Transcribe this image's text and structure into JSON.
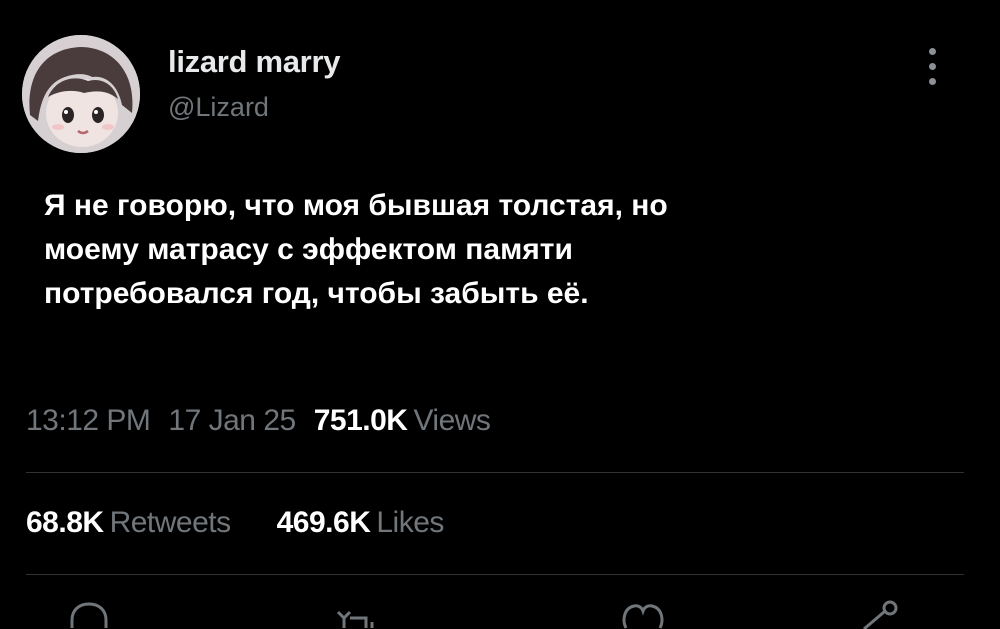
{
  "tweet": {
    "author": {
      "display_name": "lizard marry",
      "handle": "@Lizard"
    },
    "text": "Я не говорю, что моя бывшая толстая, но\nмоему матрасу с эффектом памяти\nпотребовался год, чтобы забыть её.",
    "meta": {
      "time": "13:12 PM",
      "date": "17 Jan 25",
      "views_count": "751.0K",
      "views_label": "Views"
    },
    "stats": {
      "retweets_count": "68.8K",
      "retweets_label": "Retweets",
      "likes_count": "469.6K",
      "likes_label": "Likes"
    }
  },
  "actions": {
    "icons": [
      "reply-icon",
      "retweet-icon",
      "like-icon",
      "share-icon"
    ]
  },
  "colors": {
    "background": "#000000",
    "primary_text": "#ffffff",
    "secondary_text": "#71767b",
    "divider": "#2f3336"
  }
}
